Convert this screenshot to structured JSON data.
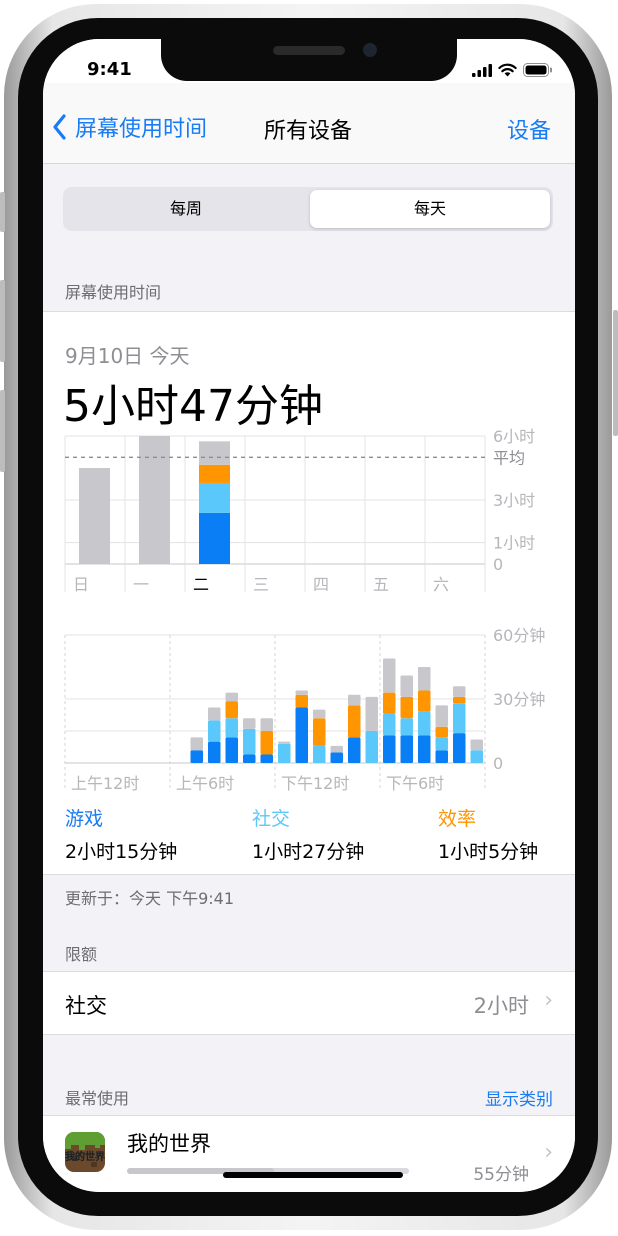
{
  "status": {
    "time": "9:41"
  },
  "nav": {
    "back_label": "屏幕使用时间",
    "title": "所有设备",
    "right_label": "设备"
  },
  "segment": {
    "options": [
      "每周",
      "每天"
    ],
    "selected": "每天"
  },
  "sections": {
    "screen_time": "屏幕使用时间",
    "limits": "限额",
    "most_used": "最常使用"
  },
  "summary": {
    "date": "9月10日 今天",
    "total": "5小时47分钟"
  },
  "colors": {
    "games": "#0a7ff5",
    "social": "#5ac8fa",
    "productivity": "#ff9500",
    "other": "#c7c7cc",
    "accent": "#1a7cf4"
  },
  "chart_data": [
    {
      "type": "bar",
      "title": "",
      "categories": [
        "日",
        "一",
        "二",
        "三",
        "四",
        "五",
        "六"
      ],
      "y_ticks": [
        "6小时",
        "平均",
        "3小时",
        "1小时",
        "0"
      ],
      "average_hours": 5,
      "ylim_hours": [
        0,
        6
      ],
      "series": [
        {
          "name": "游戏",
          "values": [
            0,
            0,
            2.4,
            0,
            0,
            0,
            0
          ]
        },
        {
          "name": "社交",
          "values": [
            0,
            0,
            1.4,
            0,
            0,
            0,
            0
          ]
        },
        {
          "name": "效率",
          "values": [
            0,
            0,
            0.85,
            0,
            0,
            0,
            0
          ]
        },
        {
          "values": [
            4.5,
            6.0,
            1.1,
            0,
            0,
            0,
            0
          ]
        }
      ]
    },
    {
      "type": "bar",
      "title": "",
      "x_ticks": [
        "上午12时",
        "上午6时",
        "下午12时",
        "下午6时"
      ],
      "y_ticks": [
        "60分钟",
        "30分钟",
        "0"
      ],
      "ylim_minutes": [
        0,
        60
      ],
      "hours": [
        0,
        1,
        2,
        3,
        4,
        5,
        6,
        7,
        8,
        9,
        10,
        11,
        12,
        13,
        14,
        15,
        16,
        17,
        18,
        19,
        20,
        21,
        22,
        23
      ],
      "series": [
        {
          "name": "游戏",
          "values": [
            0,
            0,
            0,
            0,
            0,
            0,
            0,
            6,
            10,
            12,
            4,
            4,
            0,
            26,
            0,
            5,
            12,
            0,
            13,
            13,
            13,
            6,
            14,
            0
          ]
        },
        {
          "name": "社交",
          "values": [
            0,
            0,
            0,
            0,
            0,
            0,
            0,
            0,
            10,
            9,
            12,
            0,
            9,
            0,
            8,
            0,
            0,
            15,
            10,
            8,
            11,
            6,
            14,
            6
          ]
        },
        {
          "name": "效率",
          "values": [
            0,
            0,
            0,
            0,
            0,
            0,
            0,
            0,
            0,
            8,
            0,
            11,
            0,
            6,
            13,
            0,
            15,
            0,
            10,
            10,
            10,
            5,
            3,
            0
          ]
        },
        {
          "values": [
            0,
            0,
            0,
            0,
            0,
            0,
            0,
            6,
            6,
            4,
            5,
            6,
            1,
            2,
            4,
            3,
            5,
            16,
            16,
            10,
            11,
            10,
            5,
            5
          ]
        }
      ]
    }
  ],
  "legend": [
    {
      "category": "游戏",
      "value": "2小时15分钟",
      "color": "#0a7ff5"
    },
    {
      "category": "社交",
      "value": "1小时27分钟",
      "color": "#5ac8fa"
    },
    {
      "category": "效率",
      "value": "1小时5分钟",
      "color": "#ff9500"
    }
  ],
  "updated": "更新于：今天 下午9:41",
  "limits": {
    "label": "社交",
    "value": "2小时"
  },
  "most_used": {
    "show_categories": "显示类别",
    "app_name": "我的世界",
    "app_time": "55分钟",
    "usage_fraction": 0.52,
    "icon_text": "我的世界"
  }
}
